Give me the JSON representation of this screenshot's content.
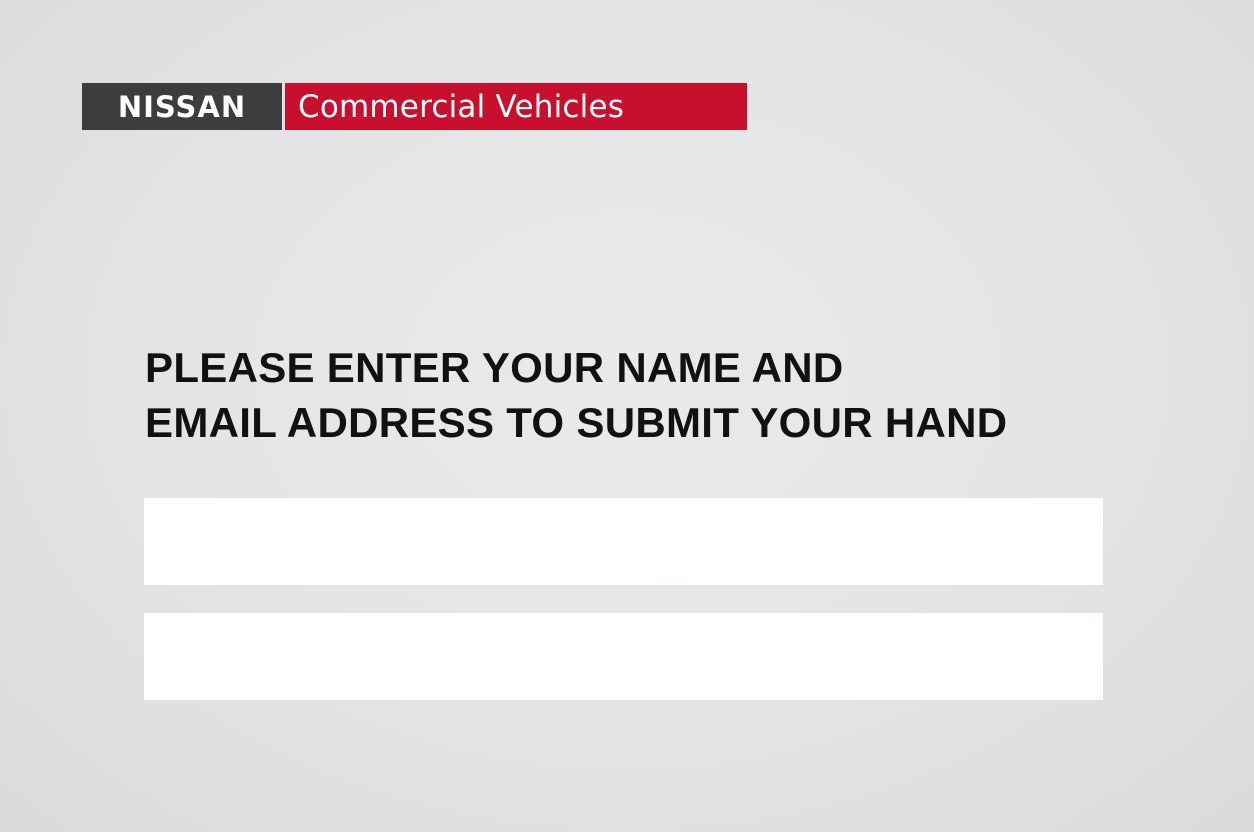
{
  "brand": {
    "primary": "NISSAN",
    "secondary": "Commercial Vehicles",
    "colors": {
      "primary_bg": "#3c3d3f",
      "secondary_bg": "#c8102e"
    }
  },
  "form": {
    "prompt_line1": "PLEASE ENTER YOUR NAME AND",
    "prompt_line2": "EMAIL ADDRESS TO SUBMIT YOUR HAND",
    "fields": [
      {
        "value": "",
        "placeholder": ""
      },
      {
        "value": "",
        "placeholder": ""
      }
    ]
  }
}
